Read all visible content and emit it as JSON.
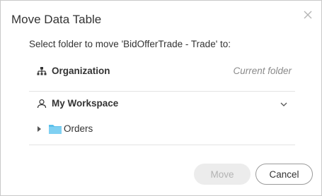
{
  "dialog": {
    "title": "Move Data Table",
    "close_icon": "close-icon",
    "subtitle": "Select folder to move 'BidOfferTrade - Trade' to:"
  },
  "folders": {
    "organization": {
      "icon": "org-hierarchy-icon",
      "label": "Organization",
      "status": "Current folder"
    },
    "workspace": {
      "icon": "user-icon",
      "label": "My Workspace",
      "expand_icon": "chevron-down-icon",
      "children": [
        {
          "icon": "folder-icon",
          "label": "Orders",
          "expand_icon": "caret-right-icon",
          "icon_color": "#5bc0eb"
        }
      ]
    }
  },
  "buttons": {
    "move_label": "Move",
    "move_enabled": false,
    "cancel_label": "Cancel"
  }
}
